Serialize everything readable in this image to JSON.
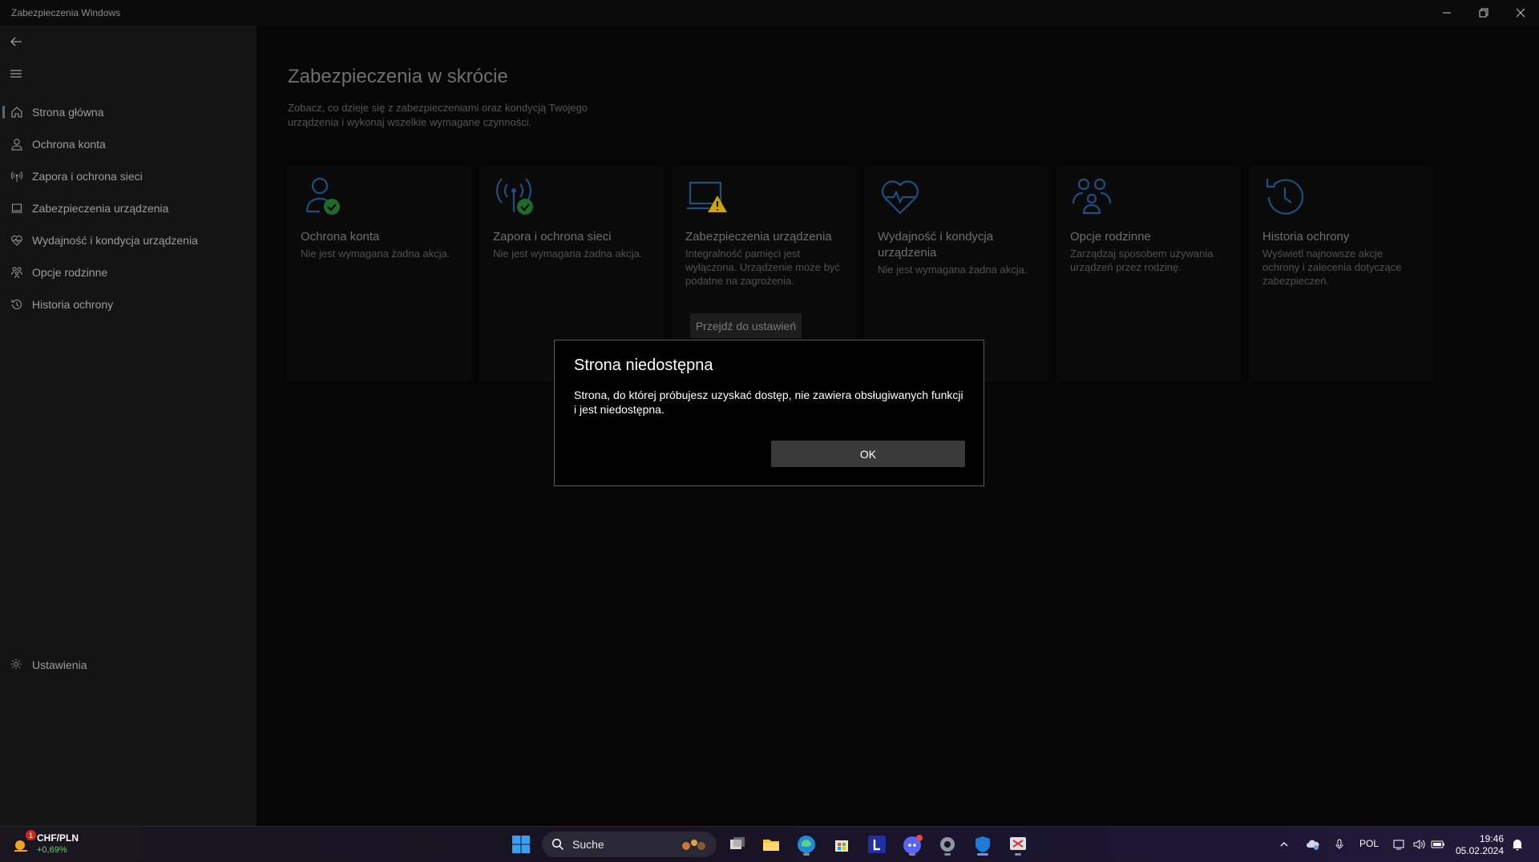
{
  "window": {
    "title": "Zabezpieczenia Windows"
  },
  "sidebar": {
    "items": [
      {
        "label": "Strona główna",
        "icon": "home-icon"
      },
      {
        "label": "Ochrona konta",
        "icon": "person-icon"
      },
      {
        "label": "Zapora i ochrona sieci",
        "icon": "wifi-antenna-icon"
      },
      {
        "label": "Zabezpieczenia urządzenia",
        "icon": "laptop-icon"
      },
      {
        "label": "Wydajność i kondycja urządzenia",
        "icon": "heart-icon"
      },
      {
        "label": "Opcje rodzinne",
        "icon": "family-icon"
      },
      {
        "label": "Historia ochrony",
        "icon": "history-icon"
      }
    ],
    "settings_label": "Ustawienia"
  },
  "main": {
    "title": "Zabezpieczenia w skrócie",
    "subtitle": "Zobacz, co dzieje się z zabezpieczeniami oraz kondycją Twojego urządzenia i wykonaj wszelkie wymagane czynności.",
    "cards": [
      {
        "title": "Ochrona konta",
        "desc": "Nie jest wymagana żadna akcja.",
        "status": "ok"
      },
      {
        "title": "Zapora i ochrona sieci",
        "desc": "Nie jest wymagana żadna akcja.",
        "status": "ok"
      },
      {
        "title": "Zabezpieczenia urządzenia",
        "desc": "Integralność pamięci jest wyłączona. Urządzenie może być podatne na zagrożenia.",
        "status": "warning",
        "button": "Przejdź do ustawień"
      },
      {
        "title": "Wydajność i kondycja urządzenia",
        "desc": "Nie jest wymagana żadna akcja.",
        "status": "none"
      },
      {
        "title": "Opcje rodzinne",
        "desc": "Zarządzaj sposobem używania urządzeń przez rodzinę.",
        "status": "none"
      },
      {
        "title": "Historia ochrony",
        "desc": "Wyświetl najnowsze akcje ochrony i zalecenia dotyczące zabezpieczeń.",
        "status": "none"
      }
    ]
  },
  "dialog": {
    "title": "Strona niedostępna",
    "message": "Strona, do której próbujesz uzyskać dostęp, nie zawiera obsługiwanych funkcji i jest niedostępna.",
    "ok_label": "OK"
  },
  "taskbar": {
    "widget": {
      "badge": "1",
      "title": "CHF/PLN",
      "change": "+0,69%"
    },
    "search_label": "Suche",
    "language": "POL",
    "time": "19:46",
    "date": "05.02.2024"
  },
  "colors": {
    "accent": "#4aa3ff",
    "ok_green": "#2e7d32",
    "warning": "#c8a415",
    "dialog_border": "#5a5a5a"
  }
}
